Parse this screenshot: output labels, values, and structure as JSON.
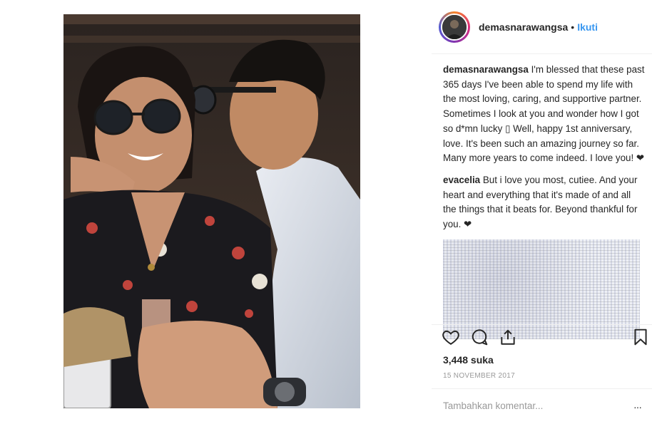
{
  "post": {
    "username": "demasnarawangsa",
    "dot": "•",
    "follow_label": "Ikuti"
  },
  "comments": [
    {
      "username": "demasnarawangsa",
      "text": "I'm blessed that these past 365 days I've been able to spend my life with the most loving, caring, and supportive partner. Sometimes I look at you and wonder how I got so d*mn lucky ▯ Well, happy 1st anniversary, love. It's been such an amazing journey so far. Many more years to come indeed. I love you! ❤"
    },
    {
      "username": "evacelia",
      "text": "But i love you most, cutiee. And your heart and everything that it's made of and all the things that it beats for. Beyond thankful for you. ❤"
    }
  ],
  "icons": {
    "like": "heart-icon",
    "comment": "comment-icon",
    "share": "share-icon",
    "save": "bookmark-icon"
  },
  "likes_text": "3,448 suka",
  "date_text": "15 NOVEMBER 2017",
  "add_comment_placeholder": "Tambahkan komentar...",
  "more_label": "···",
  "colors": {
    "link": "#3897f0",
    "text": "#262626",
    "muted": "#999999"
  }
}
